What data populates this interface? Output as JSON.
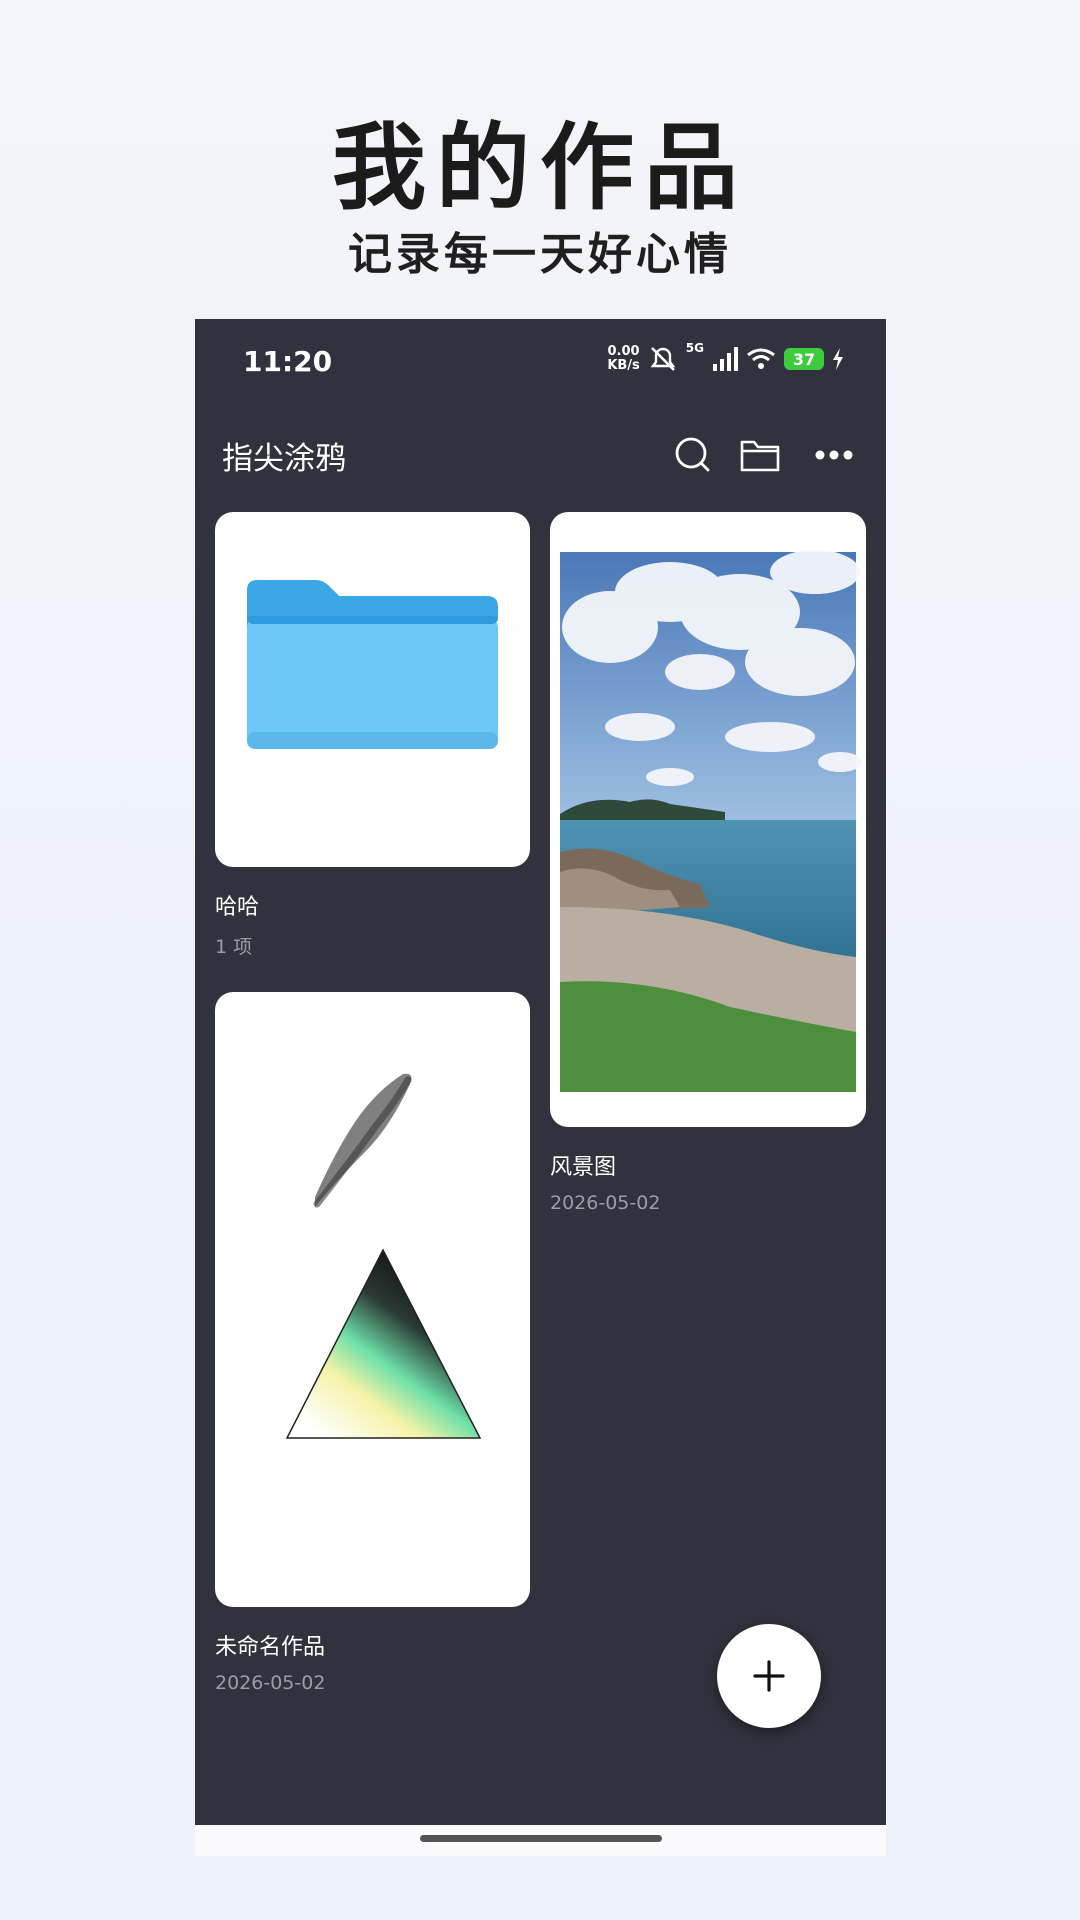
{
  "hero": {
    "title": "我的作品",
    "subtitle": "记录每一天好心情"
  },
  "status_bar": {
    "time": "11:20",
    "net_speed_value": "0.00",
    "net_speed_unit": "KB/s",
    "network": "5G",
    "battery": "37"
  },
  "appbar": {
    "title": "指尖涂鸦",
    "icons": [
      "search-icon",
      "folder-icon",
      "more-icon"
    ]
  },
  "items": [
    {
      "type": "folder",
      "name": "哈哈",
      "meta": "1 项"
    },
    {
      "type": "image",
      "name": "风景图",
      "meta": "2026-05-02"
    },
    {
      "type": "drawing",
      "name": "未命名作品",
      "meta": "2026-05-02"
    }
  ],
  "fab": {
    "icon": "plus-icon"
  },
  "colors": {
    "app_background": "#30333d",
    "card": "#ffffff",
    "folder": "#6cc7f7",
    "battery": "#3ecb3e"
  }
}
